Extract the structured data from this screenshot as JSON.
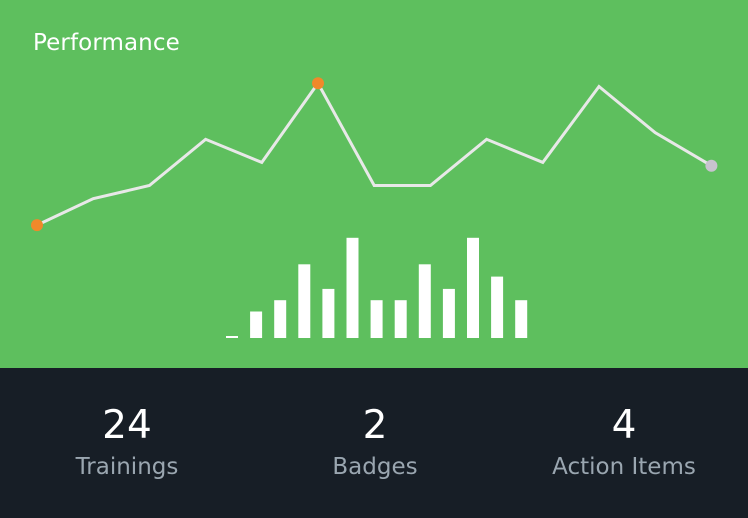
{
  "card": {
    "title": "Performance"
  },
  "chart_data": {
    "type": "line",
    "series": [
      {
        "values": [
          2.3,
          3.1,
          3.5,
          4.9,
          4.2,
          6.6,
          3.5,
          3.5,
          4.9,
          4.2,
          6.5,
          5.1,
          4.1
        ],
        "color": "#e8e8e8",
        "highlighted_points": [
          {
            "index": 0,
            "color": "#f0892a"
          },
          {
            "index": 5,
            "color": "#f0892a"
          },
          {
            "index": 12,
            "color": "#c8c3cf"
          }
        ]
      },
      {
        "type": "bar",
        "values": [
          0.2,
          2.8,
          4,
          7.8,
          5.2,
          10.6,
          4,
          4,
          7.8,
          5.2,
          10.6,
          6.5,
          4
        ],
        "color": "#ffffff"
      }
    ]
  },
  "stats": [
    {
      "value": "24",
      "label": "Trainings"
    },
    {
      "value": "2",
      "label": "Badges"
    },
    {
      "value": "4",
      "label": "Action Items"
    }
  ],
  "colors": {
    "hero_background": "#5ebf5e",
    "stats_background": "#171e26",
    "value_text": "#ffffff",
    "label_text": "#9aa6b0"
  }
}
